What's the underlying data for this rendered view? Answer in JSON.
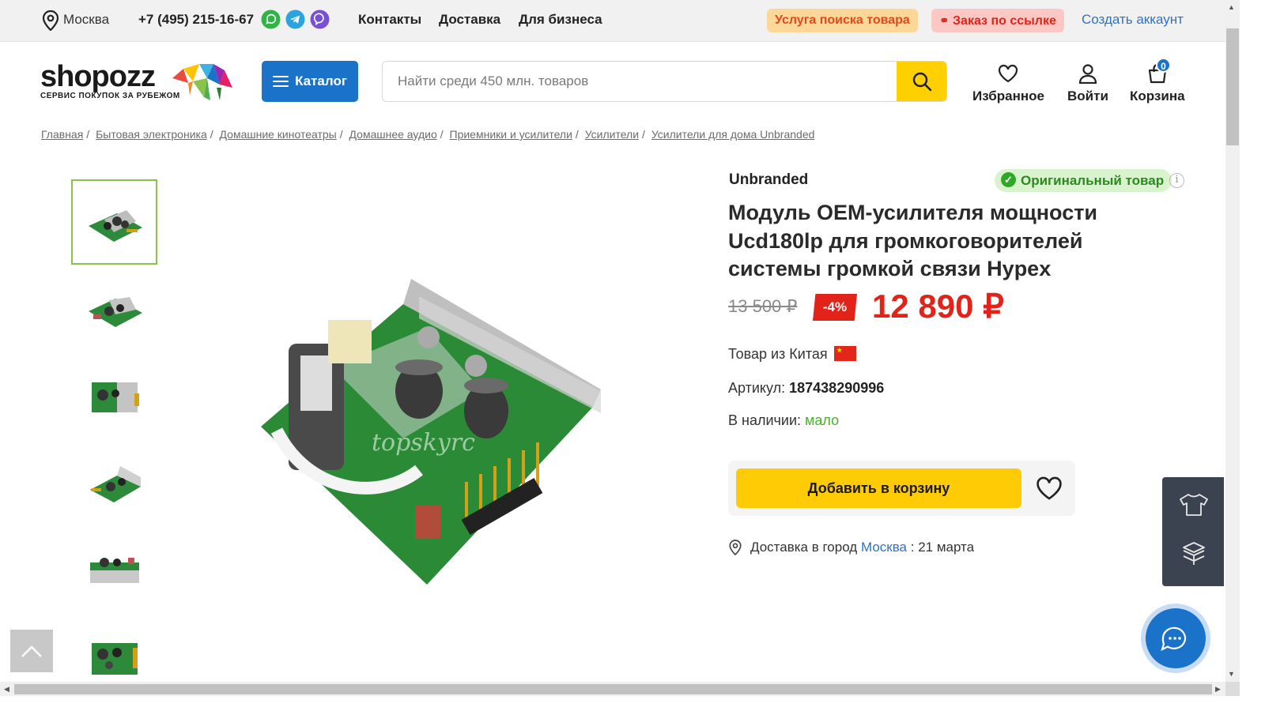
{
  "topbar": {
    "city": "Москва",
    "phone": "+7 (495) 215-16-67",
    "nav": [
      "Контакты",
      "Доставка",
      "Для бизнеса"
    ],
    "search_service": "Услуга поиска товара",
    "order_by_link": "Заказ по ссылке",
    "create_account": "Создать аккаунт"
  },
  "logo": {
    "name": "shopozz",
    "tagline": "СЕРВИС ПОКУПОК ЗА РУБЕЖОМ"
  },
  "catalog_label": "Каталог",
  "search": {
    "placeholder": "Найти среди 450 млн. товаров"
  },
  "header_actions": {
    "favorites": "Избранное",
    "login": "Войти",
    "cart": "Корзина",
    "cart_count": "0"
  },
  "breadcrumbs": [
    "Главная",
    "Бытовая электроника",
    "Домашние кинотеатры",
    "Домашнее аудио",
    "Приемники и усилители",
    "Усилители",
    "Усилители для дома Unbranded"
  ],
  "product": {
    "brand": "Unbranded",
    "original_badge": "Оригинальный товар",
    "title": "Модуль OEM-усилителя мощности Ucd180lp для громкоговорителей системы громкой связи Hypex",
    "old_price": "13 500 ₽",
    "discount": "-4%",
    "price": "12 890 ₽",
    "origin_label": "Товар из Китая",
    "sku_label": "Артикул:",
    "sku": "187438290996",
    "stock_label": "В наличии:",
    "stock_value": "мало",
    "add_to_cart": "Добавить в корзину",
    "delivery_label": "Доставка в город",
    "delivery_city": "Москва",
    "delivery_date": ": 21 марта",
    "watermark": "topskyrc"
  },
  "colors": {
    "accent_blue": "#1a73c8",
    "yellow": "#ffcb05",
    "red": "#e2231a",
    "green": "#2ea826"
  }
}
